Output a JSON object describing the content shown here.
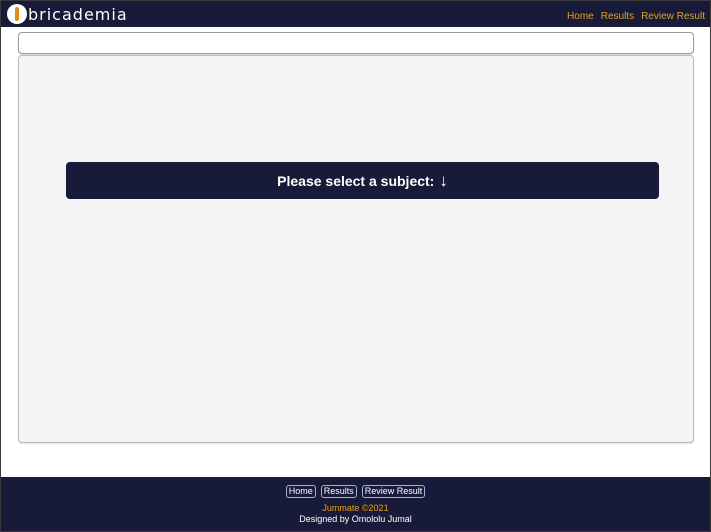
{
  "header": {
    "logo_text": "bricademia",
    "nav": [
      "Home",
      "Results",
      "Review Result"
    ]
  },
  "main": {
    "select_prompt": "Please select a subject:",
    "select_arrow": "↓"
  },
  "footer": {
    "nav": [
      "Home",
      "Results",
      "Review Result"
    ],
    "copyright": "Jummate ©2021",
    "designer": "Designed by Omololu Jumal"
  },
  "colors": {
    "navy": "#171a38",
    "accent": "#e8a21c",
    "panel": "#f4f4f4"
  }
}
